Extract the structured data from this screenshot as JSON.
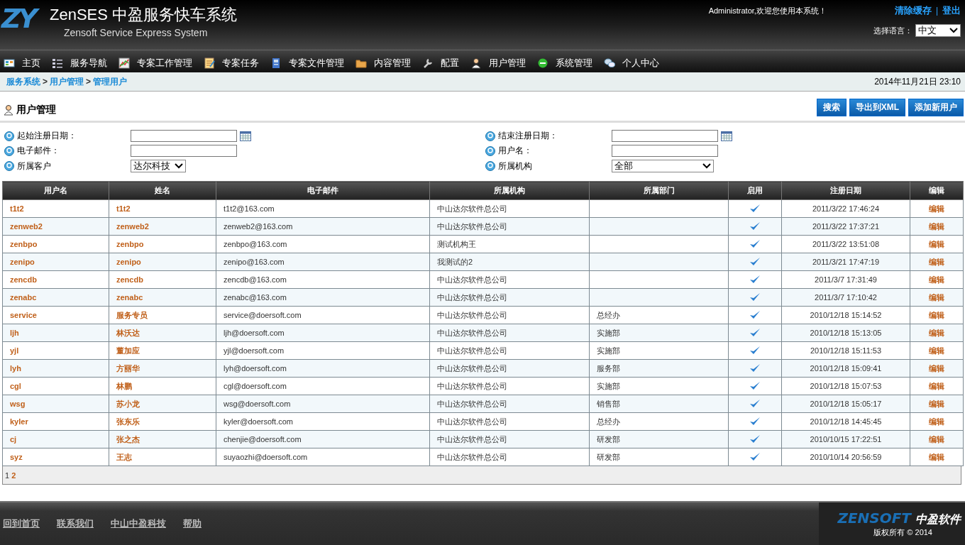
{
  "header": {
    "logo": "ZY",
    "title": "ZenSES 中盈服务快车系统",
    "subtitle": "Zensoft Service Express System",
    "welcome": "Administrator,欢迎您使用本系统！",
    "links": [
      "清除缓存",
      "登出"
    ],
    "link_separator": "|",
    "language_label": "选择语言：",
    "language": "中文"
  },
  "nav": [
    "主页",
    "服务导航",
    "专案工作管理",
    "专案任务",
    "专案文件管理",
    "内容管理",
    "配置",
    "用户管理",
    "系统管理",
    "个人中心"
  ],
  "breadcrumb": [
    "服务系统",
    "用户管理",
    "管理用户"
  ],
  "breadcrumb_separator": ">",
  "datetime": "2014年11月21日 23:10",
  "page_title": "用户管理",
  "buttons": [
    "搜索",
    "导出到XML",
    "添加新用户"
  ],
  "filters": [
    {
      "label": "起始注册日期：",
      "kind": "date"
    },
    {
      "label": "结束注册日期：",
      "kind": "date"
    },
    {
      "label": "电子邮件：",
      "kind": "text"
    },
    {
      "label": "用户名：",
      "kind": "text"
    },
    {
      "label": "所属客户",
      "kind": "select",
      "value": "达尔科技"
    },
    {
      "label": "所属机构",
      "kind": "select",
      "value": "全部"
    }
  ],
  "table": {
    "columns": [
      "用户名",
      "姓名",
      "电子邮件",
      "所属机构",
      "所属部门",
      "启用",
      "注册日期",
      "编辑"
    ],
    "rows": [
      {
        "username": "t1t2",
        "name": "t1t2",
        "email": "t1t2@163.com",
        "org": "中山达尔软件总公司",
        "enabled": true,
        "date": "2011/3/22 17:46:24",
        "edit": "编辑"
      },
      {
        "username": "zenweb2",
        "name": "zenweb2",
        "email": "zenweb2@163.com",
        "org": "中山达尔软件总公司",
        "enabled": true,
        "date": "2011/3/22 17:37:21",
        "edit": "编辑"
      },
      {
        "username": "zenbpo",
        "name": "zenbpo",
        "email": "zenbpo@163.com",
        "org": "测试机构王",
        "enabled": true,
        "date": "2011/3/22 13:51:08",
        "edit": "编辑"
      },
      {
        "username": "zenipo",
        "name": "zenipo",
        "email": "zenipo@163.com",
        "org": "我测试的2",
        "enabled": true,
        "date": "2011/3/21 17:47:19",
        "edit": "编辑"
      },
      {
        "username": "zencdb",
        "name": "zencdb",
        "email": "zencdb@163.com",
        "org": "中山达尔软件总公司",
        "enabled": true,
        "date": "2011/3/7 17:31:49",
        "edit": "编辑"
      },
      {
        "username": "zenabc",
        "name": "zenabc",
        "email": "zenabc@163.com",
        "org": "中山达尔软件总公司",
        "enabled": true,
        "date": "2011/3/7 17:10:42",
        "edit": "编辑"
      },
      {
        "username": "service",
        "name": "服务专员",
        "email": "service@doersoft.com",
        "org": "中山达尔软件总公司",
        "dept": "总经办",
        "enabled": true,
        "date": "2010/12/18 15:14:52",
        "edit": "编辑"
      },
      {
        "username": "ljh",
        "name": "林沃达",
        "email": "ljh@doersoft.com",
        "org": "中山达尔软件总公司",
        "dept": "实施部",
        "enabled": true,
        "date": "2010/12/18 15:13:05",
        "edit": "编辑"
      },
      {
        "username": "yjl",
        "name": "董加应",
        "email": "yjl@doersoft.com",
        "org": "中山达尔软件总公司",
        "dept": "实施部",
        "enabled": true,
        "date": "2010/12/18 15:11:53",
        "edit": "编辑"
      },
      {
        "username": "lyh",
        "name": "方丽华",
        "email": "lyh@doersoft.com",
        "org": "中山达尔软件总公司",
        "dept": "服务部",
        "enabled": true,
        "date": "2010/12/18 15:09:41",
        "edit": "编辑"
      },
      {
        "username": "cgl",
        "name": "林鹏",
        "email": "cgl@doersoft.com",
        "org": "中山达尔软件总公司",
        "dept": "实施部",
        "enabled": true,
        "date": "2010/12/18 15:07:53",
        "edit": "编辑"
      },
      {
        "username": "wsg",
        "name": "苏小龙",
        "email": "wsg@doersoft.com",
        "org": "中山达尔软件总公司",
        "dept": "销售部",
        "enabled": true,
        "date": "2010/12/18 15:05:17",
        "edit": "编辑"
      },
      {
        "username": "kyler",
        "name": "张东乐",
        "email": "kyler@doersoft.com",
        "org": "中山达尔软件总公司",
        "dept": "总经办",
        "enabled": true,
        "date": "2010/12/18 14:45:45",
        "edit": "编辑"
      },
      {
        "username": "cj",
        "name": "张之杰",
        "email": "chenjie@doersoft.com",
        "org": "中山达尔软件总公司",
        "dept": "研发部",
        "enabled": true,
        "date": "2010/10/15 17:22:51",
        "edit": "编辑"
      },
      {
        "username": "syz",
        "name": "王志",
        "email": "suyaozhi@doersoft.com",
        "org": "中山达尔软件总公司",
        "dept": "研发部",
        "enabled": true,
        "date": "2010/10/14 20:56:59",
        "edit": "编辑"
      }
    ]
  },
  "pager": [
    {
      "label": "1",
      "selected": true
    },
    {
      "label": "2",
      "selected": false
    }
  ],
  "footer": {
    "links": [
      "回到首页",
      "联系我们",
      "中山中盈科技",
      "帮助"
    ],
    "brand": "ZENSOFT",
    "brand_cn": "中盈软件",
    "copyright": "版权所有 © 2014"
  }
}
